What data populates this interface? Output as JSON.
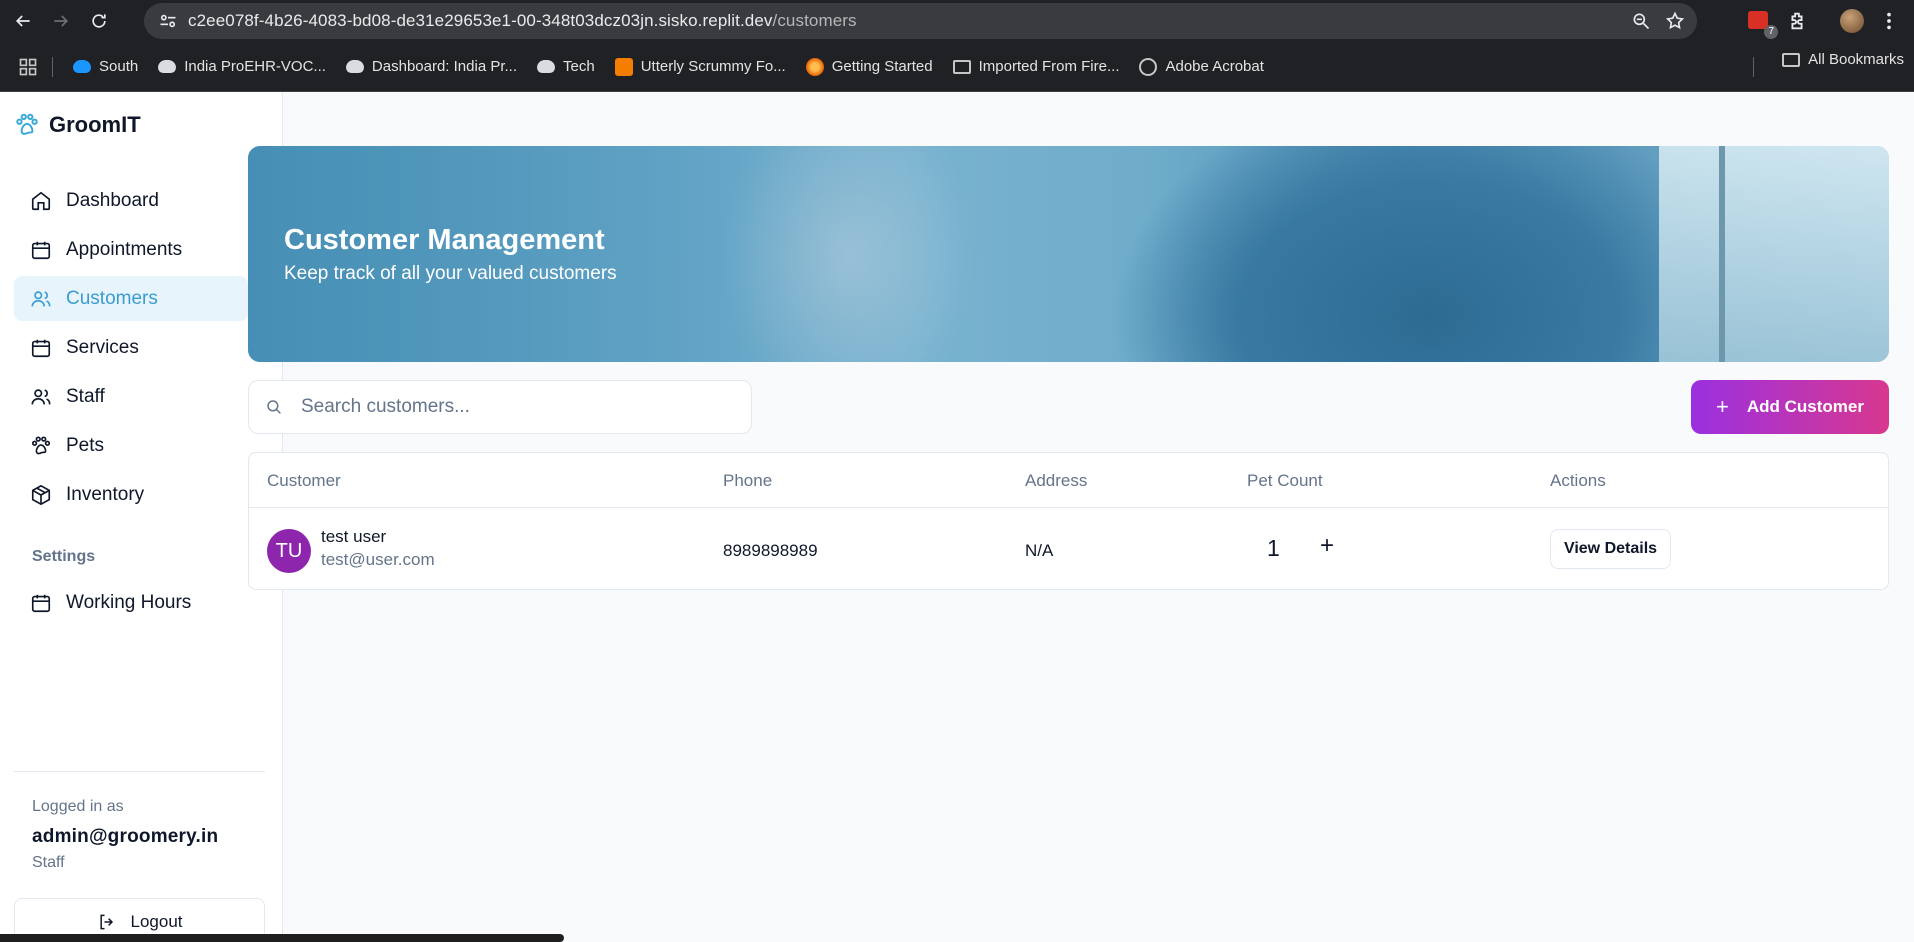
{
  "browser": {
    "url_host": "c2ee078f-4b26-4083-bd08-de31e29653e1-00-348t03dcz03jn.sisko.replit.dev",
    "url_path": "/customers",
    "extension_badge": "7",
    "bookmarks": [
      {
        "label": "South",
        "icon": "cloud-icon"
      },
      {
        "label": "India ProEHR-VOC...",
        "icon": "cloud-icon"
      },
      {
        "label": "Dashboard: India Pr...",
        "icon": "cloud-icon"
      },
      {
        "label": "Tech",
        "icon": "cloud-icon"
      },
      {
        "label": "Utterly Scrummy Fo...",
        "icon": "blogger-icon"
      },
      {
        "label": "Getting Started",
        "icon": "firefox-icon"
      },
      {
        "label": "Imported From Fire...",
        "icon": "folder-icon"
      },
      {
        "label": "Adobe Acrobat",
        "icon": "globe-icon"
      }
    ],
    "all_bookmarks": "All Bookmarks"
  },
  "app": {
    "brand": "GroomIT",
    "nav": [
      {
        "label": "Dashboard",
        "icon": "home-icon"
      },
      {
        "label": "Appointments",
        "icon": "calendar-icon"
      },
      {
        "label": "Customers",
        "icon": "users-icon",
        "active": true
      },
      {
        "label": "Services",
        "icon": "calendar-icon"
      },
      {
        "label": "Staff",
        "icon": "users-icon"
      },
      {
        "label": "Pets",
        "icon": "paw-icon"
      },
      {
        "label": "Inventory",
        "icon": "package-icon"
      }
    ],
    "settings_heading": "Settings",
    "settings_nav": [
      {
        "label": "Working Hours",
        "icon": "calendar-icon"
      }
    ],
    "user": {
      "logged_in_label": "Logged in as",
      "email": "admin@groomery.in",
      "role": "Staff"
    },
    "logout_label": "Logout",
    "accent_color": "#3b9cd0"
  },
  "main": {
    "hero_title": "Customer Management",
    "hero_subtitle": "Keep track of all your valued customers",
    "search_placeholder": "Search customers...",
    "add_button": "Add Customer",
    "table": {
      "headers": [
        "Customer",
        "Phone",
        "Address",
        "Pet Count",
        "Actions"
      ],
      "rows": [
        {
          "initials": "TU",
          "name": "test user",
          "email": "test@user.com",
          "phone": "8989898989",
          "address": "N/A",
          "pet_count": "1",
          "action": "View Details"
        }
      ]
    }
  }
}
